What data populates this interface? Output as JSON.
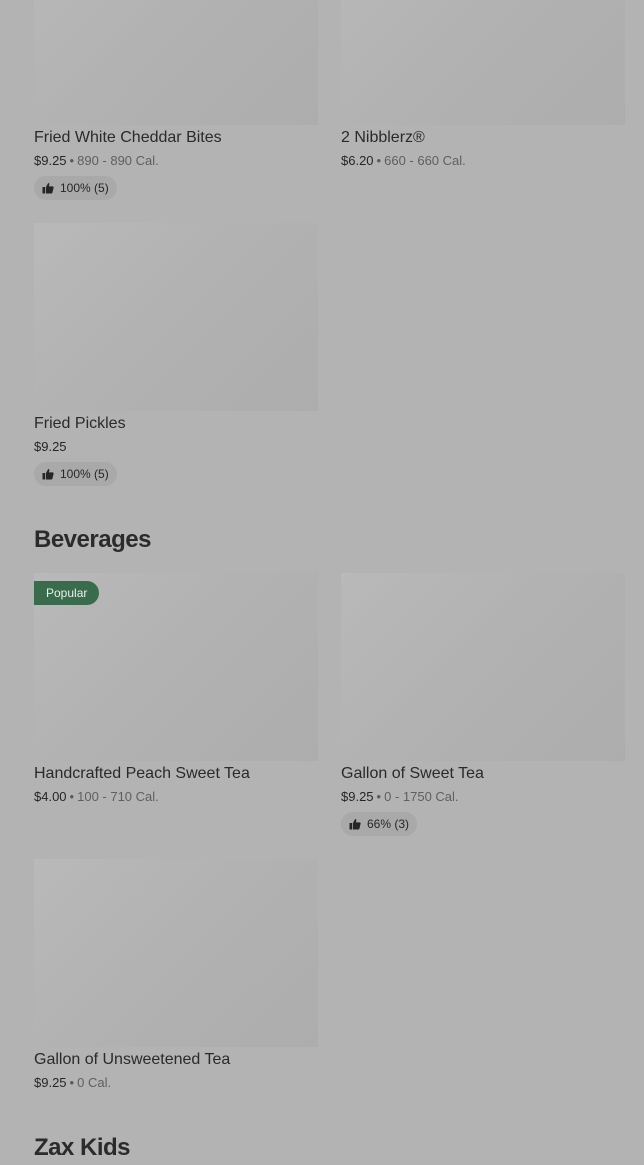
{
  "sections": {
    "beverages_title": "Beverages",
    "zax_kids_title": "Zax Kids"
  },
  "items": [
    {
      "name": "Fried White Cheddar Bites",
      "price": "$9.25",
      "separator": "•",
      "calories": "890 - 890 Cal.",
      "rating": "100% (5)"
    },
    {
      "name": "2 Nibblerz®",
      "price": "$6.20",
      "separator": "•",
      "calories": "660 - 660 Cal."
    },
    {
      "name": "Fried Pickles",
      "price": "$9.25",
      "rating": "100% (5)"
    },
    {
      "name": "Handcrafted Peach Sweet Tea",
      "badge": "Popular",
      "price": "$4.00",
      "separator": "•",
      "calories": "100 - 710 Cal."
    },
    {
      "name": "Gallon of Sweet Tea",
      "price": "$9.25",
      "separator": "•",
      "calories": "0 - 1750 Cal.",
      "rating": "66% (3)"
    },
    {
      "name": "Gallon of Unsweetened Tea",
      "price": "$9.25",
      "separator": "•",
      "calories": "0 Cal."
    }
  ],
  "icons": {
    "rating_icon": "thumbs-up-icon"
  },
  "colors": {
    "badge_bg": "#3a6b4c",
    "overlay_bg": "#b3b3b3"
  }
}
